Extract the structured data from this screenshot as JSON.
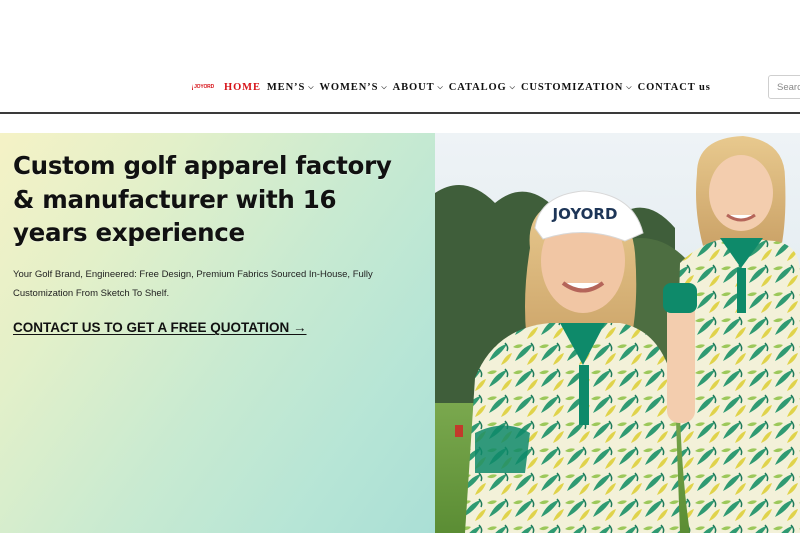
{
  "header": {
    "logo_text": "JOYORD",
    "nav": [
      {
        "label": "HOME",
        "has_caret": false,
        "active": true
      },
      {
        "label": "MEN’S",
        "has_caret": true,
        "active": false
      },
      {
        "label": "WOMEN’S",
        "has_caret": true,
        "active": false
      },
      {
        "label": "ABOUT",
        "has_caret": true,
        "active": false
      },
      {
        "label": "CATALOG",
        "has_caret": true,
        "active": false
      },
      {
        "label": "CUSTOMIZATION",
        "has_caret": true,
        "active": false
      },
      {
        "label": "CONTACT us",
        "has_caret": false,
        "active": false
      }
    ],
    "search_placeholder": "Search"
  },
  "hero": {
    "title": "Custom golf apparel factory & manufacturer with 16 years experience",
    "subtitle": "Your Golf Brand, Engineered: Free Design, Premium Fabrics Sourced In-House, Fully Customization From Sketch To Shelf.",
    "cta": "CONTACT US TO GET A FREE QUOTATION →",
    "visor_text": "JOYORD"
  },
  "colors": {
    "brand_red": "#d7141a",
    "text_dark": "#111111",
    "polo_green": "#0e8a6a"
  }
}
